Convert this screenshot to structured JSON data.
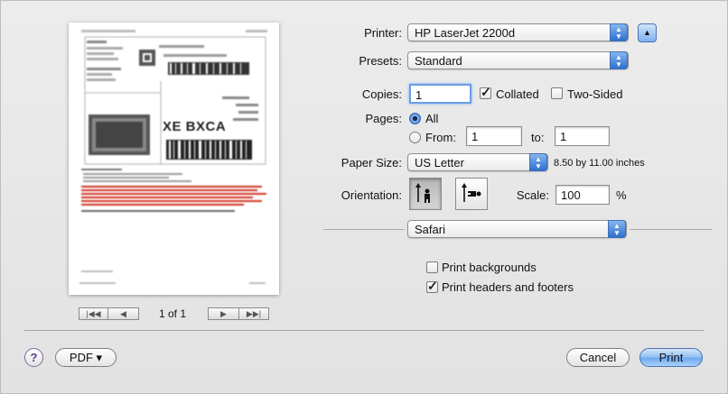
{
  "printer": {
    "label": "Printer:",
    "value": "HP LaserJet 2200d"
  },
  "presets": {
    "label": "Presets:",
    "value": "Standard"
  },
  "copies": {
    "label": "Copies:",
    "value": "1",
    "collated_label": "Collated",
    "collated": true,
    "two_sided_label": "Two-Sided",
    "two_sided": false
  },
  "pages": {
    "label": "Pages:",
    "all_label": "All",
    "all_selected": true,
    "from_label": "From:",
    "from_value": "1",
    "to_label": "to:",
    "to_value": "1"
  },
  "paper": {
    "label": "Paper Size:",
    "value": "US Letter",
    "dimensions": "8.50 by 11.00 inches"
  },
  "orientation": {
    "label": "Orientation:",
    "selected": "portrait"
  },
  "scale": {
    "label": "Scale:",
    "value": "100",
    "unit": "%"
  },
  "app_menu": {
    "value": "Safari"
  },
  "options": {
    "print_backgrounds": "Print backgrounds",
    "print_backgrounds_checked": false,
    "print_headers": "Print headers and footers",
    "print_headers_checked": true
  },
  "preview": {
    "page_indicator": "1 of 1",
    "label_text": "XE BXCA"
  },
  "footer": {
    "help": "?",
    "pdf": "PDF ▾",
    "cancel": "Cancel",
    "print": "Print"
  },
  "colors": {
    "accent": "#3a78d6",
    "warning_text": "#d03020"
  }
}
